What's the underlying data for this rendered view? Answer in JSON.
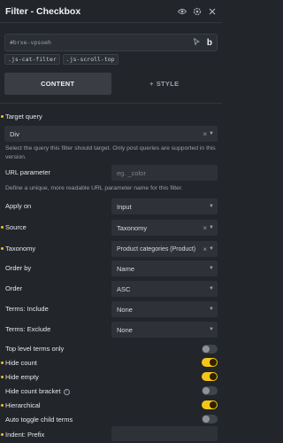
{
  "header": {
    "title": "Filter - Checkbox"
  },
  "element": {
    "id": "#brxe-vpsoeh",
    "brand_letter": "b"
  },
  "classes": [
    ".js-cat-filter",
    ".js-scroll-top"
  ],
  "tabs": [
    {
      "label": "CONTENT",
      "active": true
    },
    {
      "label": "STYLE",
      "active": false
    }
  ],
  "target_query": {
    "label": "Target query",
    "value": "Div",
    "description": "Select the query this filter should target. Only post queries are supported in this version."
  },
  "url_parameter": {
    "label": "URL parameter",
    "placeholder": "eg. _color",
    "description": "Define a unique, more readable URL parameter name for this filter."
  },
  "apply_on": {
    "label": "Apply on",
    "value": "Input"
  },
  "source": {
    "label": "Source",
    "value": "Taxonomy"
  },
  "taxonomy": {
    "label": "Taxonomy",
    "value": "Product categories (Product)"
  },
  "order_by": {
    "label": "Order by",
    "value": "Name"
  },
  "order": {
    "label": "Order",
    "value": "ASC"
  },
  "terms_include": {
    "label": "Terms: Include",
    "value": "None"
  },
  "terms_exclude": {
    "label": "Terms: Exclude",
    "value": "None"
  },
  "toggles": [
    {
      "label": "Top level terms only",
      "on": false
    },
    {
      "label": "Hide count",
      "on": true
    },
    {
      "label": "Hide empty",
      "on": true
    },
    {
      "label": "Hide count bracket",
      "on": false
    },
    {
      "label": "Hierarchical",
      "on": true
    },
    {
      "label": "Auto toggle child terms",
      "on": false
    }
  ],
  "indent_prefix": {
    "label": "Indent: Prefix",
    "value": ""
  },
  "colors": {
    "accent": "#f5c518",
    "background": "#22252a",
    "field": "#2e3137"
  }
}
